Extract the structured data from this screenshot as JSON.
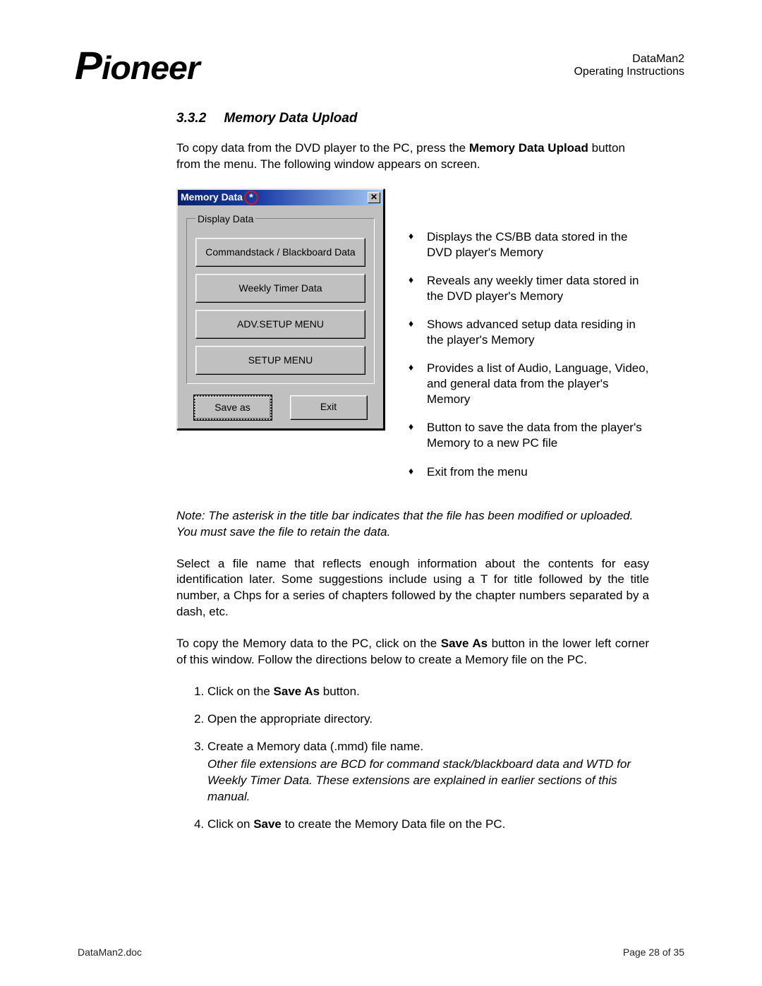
{
  "header": {
    "logo_text": "Pioneer",
    "doc_title": "DataMan2",
    "doc_subtitle": "Operating Instructions"
  },
  "section": {
    "number": "3.3.2",
    "title": "Memory Data Upload"
  },
  "intro": {
    "part1": "To copy data from the DVD player to the PC, press the ",
    "bold": "Memory Data Upload",
    "part2": " button from the menu. The following window appears on screen."
  },
  "dialog": {
    "title": "Memory Data",
    "asterisk": "*",
    "close_glyph": "✕",
    "group_legend": "Display Data",
    "buttons": {
      "cs_bb": "Commandstack / Blackboard Data",
      "weekly": "Weekly Timer Data",
      "adv": "ADV.SETUP MENU",
      "setup": "SETUP MENU",
      "save_as": "Save as",
      "exit": "Exit"
    }
  },
  "features": {
    "f0": "Displays the CS/BB data stored in the DVD player's Memory",
    "f1": "Reveals any weekly timer data stored in the DVD player's Memory",
    "f2": "Shows advanced setup data residing in the player's Memory",
    "f3": "Provides a list of Audio, Language, Video, and general data from the player's Memory",
    "f4": "Button to save the data from the player's Memory to a new PC file",
    "f5": "Exit from the menu"
  },
  "note_text": "Note: The asterisk in the title bar indicates that the file has been modified or uploaded. You must save the file to retain the data.",
  "para2": "Select a file name that reflects enough information about the contents for easy identification later.  Some suggestions include using a T for title followed by the title number, a Chps for a series of chapters followed by the chapter numbers separated by a dash, etc.",
  "para3": {
    "part1": "To copy the Memory data to the PC, click on the ",
    "bold": "Save As",
    "part2": " button in the lower left corner of this window. Follow the directions below to create a Memory file on the PC."
  },
  "steps": {
    "s1a": "Click on the ",
    "s1b": "Save As",
    "s1c": " button.",
    "s2": "Open the appropriate directory.",
    "s3a": "Create a Memory data (.mmd) file name.",
    "s3b": "Other file extensions are BCD for command stack/blackboard data and WTD for Weekly Timer Data.  These extensions are explained in earlier sections of this manual.",
    "s4a": "Click on ",
    "s4b": "Save",
    "s4c": " to create the Memory Data file on the PC."
  },
  "footer": {
    "left": "DataMan2.doc",
    "right": "Page 28 of 35"
  }
}
